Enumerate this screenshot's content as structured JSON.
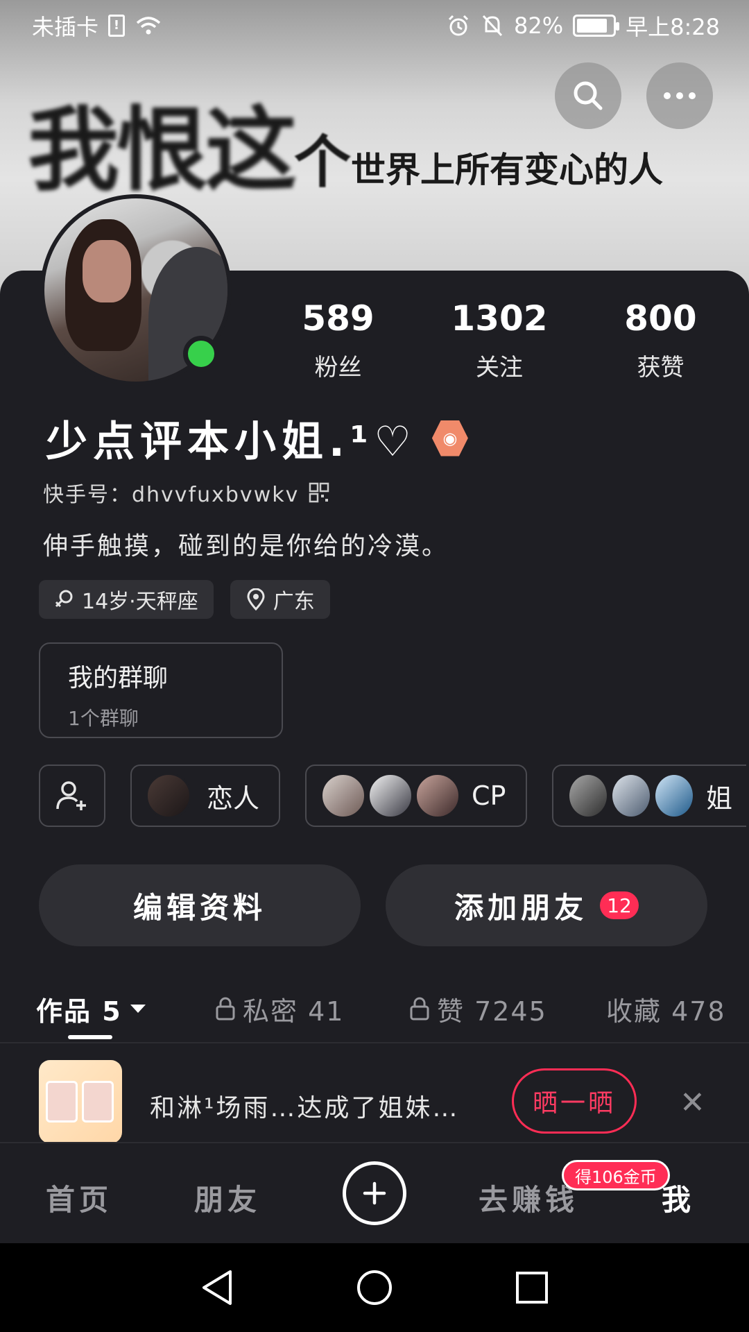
{
  "status_bar": {
    "carrier": "未插卡",
    "battery": "82%",
    "battery_level": 0.82,
    "time": "早上8:28"
  },
  "banner": {
    "text_big": "我恨这",
    "text_mid": "个",
    "text_small": "世界上所有变心的人"
  },
  "top_actions": {
    "search_icon": "search-icon",
    "more_icon": "more-icon"
  },
  "stats": [
    {
      "value": "589",
      "label": "粉丝"
    },
    {
      "value": "1302",
      "label": "关注"
    },
    {
      "value": "800",
      "label": "获赞"
    }
  ],
  "profile": {
    "name": "少点评本小姐.¹♡",
    "kuaishou_id": "快手号：dhvvfuxbvwkv",
    "bio": "伸手触摸，碰到的是你给的冷漠。",
    "tags": [
      "14岁·天秤座",
      "广东"
    ],
    "online_color": "#37d04b"
  },
  "group_chat": {
    "title": "我的群聊",
    "subtitle": "1个群聊"
  },
  "relations": [
    {
      "label": "恋人"
    },
    {
      "label": "CP"
    },
    {
      "label": "姐"
    }
  ],
  "actions": {
    "edit_profile": "编辑资料",
    "add_friend": "添加朋友",
    "add_friend_count": "12"
  },
  "content_tabs": [
    {
      "label": "作品 5"
    },
    {
      "label": "私密 41"
    },
    {
      "label": "赞 7245"
    },
    {
      "label": "收藏 478"
    }
  ],
  "promo": {
    "text": "和淋¹场雨…达成了姐妹…",
    "button": "晒一晒"
  },
  "bottom_nav": {
    "home": "首页",
    "friends": "朋友",
    "earn": "去赚钱",
    "earn_badge": "得106金币",
    "me": "我"
  },
  "colors": {
    "accent": "#ff2d55",
    "card_bg": "#1e1e23"
  }
}
